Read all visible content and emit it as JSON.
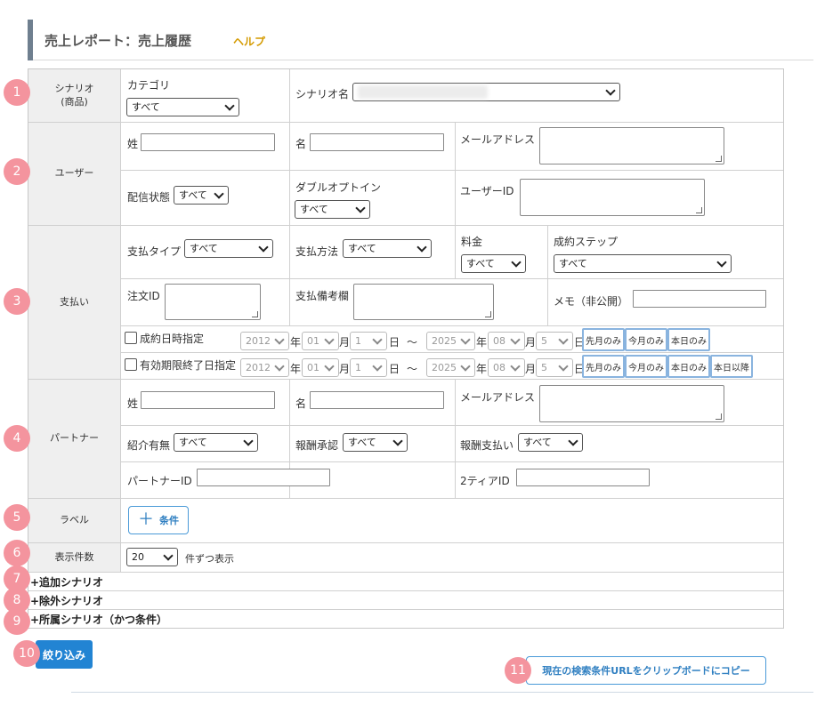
{
  "header": {
    "title": "売上レポート：売上履歴",
    "help": "ヘルプ"
  },
  "badges": [
    "1",
    "2",
    "3",
    "4",
    "5",
    "6",
    "7",
    "8",
    "9",
    "10",
    "11"
  ],
  "scenario": {
    "label": "シナリオ\n(商品)",
    "category_label": "カテゴリ",
    "category_value": "すべて",
    "name_label": "シナリオ名"
  },
  "user": {
    "label": "ユーザー",
    "last_name": "姓",
    "first_name": "名",
    "email": "メールアドレス",
    "delivery_status": "配信状態",
    "delivery_value": "すべて",
    "double_optin": "ダブルオプトイン",
    "double_optin_value": "すべて",
    "user_id": "ユーザーID"
  },
  "payment": {
    "label": "支払い",
    "pay_type": "支払タイプ",
    "pay_type_value": "すべて",
    "pay_method": "支払方法",
    "pay_method_value": "すべて",
    "fee": "料金",
    "fee_value": "すべて",
    "step": "成約ステップ",
    "step_value": "すべて",
    "order_id": "注文ID",
    "remarks": "支払備考欄",
    "memo": "メモ（非公開）",
    "date1_label": "成約日時指定",
    "date2_label": "有効期限終了日指定",
    "from_year": "2012",
    "from_month": "01",
    "from_day": "1",
    "to_year": "2025",
    "to_month": "08",
    "to_day": "5",
    "year_unit": "年",
    "month_unit": "月",
    "day_unit": "日",
    "tilde": "～",
    "btn_last_month": "先月のみ",
    "btn_this_month": "今月のみ",
    "btn_today": "本日のみ",
    "btn_after_today": "本日以降"
  },
  "partner": {
    "label": "パートナー",
    "last_name": "姓",
    "first_name": "名",
    "email": "メールアドレス",
    "referral": "紹介有無",
    "referral_value": "すべて",
    "reward_approval": "報酬承認",
    "reward_approval_value": "すべて",
    "reward_payment": "報酬支払い",
    "reward_payment_value": "すべて",
    "partner_id": "パートナーID",
    "tier2_id": "2ティアID"
  },
  "label_row": {
    "label": "ラベル",
    "button": "条件"
  },
  "display": {
    "label": "表示件数",
    "value": "20",
    "suffix": "件ずつ表示"
  },
  "collapsibles": {
    "add_scenario": "+追加シナリオ",
    "exclude_scenario": "+除外シナリオ",
    "belong_scenario": "+所属シナリオ（かつ条件）"
  },
  "actions": {
    "filter": "絞り込み",
    "copy_url": "現在の検索条件URLをクリップボードにコピー"
  }
}
